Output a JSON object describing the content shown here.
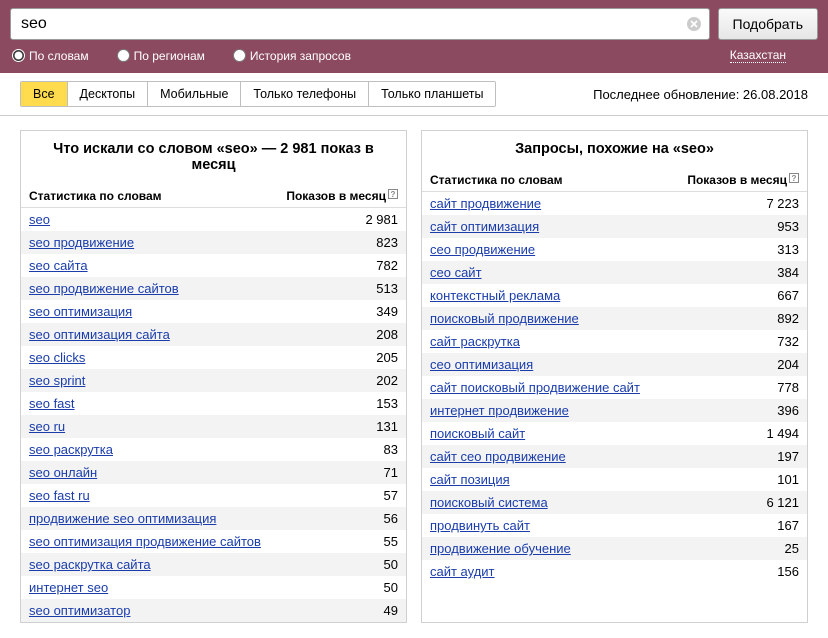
{
  "search": {
    "value": "seo",
    "button": "Подобрать"
  },
  "options": {
    "words": "По словам",
    "regions": "По регионам",
    "history": "История запросов",
    "region_link": "Казахстан"
  },
  "tabs": [
    "Все",
    "Десктопы",
    "Мобильные",
    "Только телефоны",
    "Только планшеты"
  ],
  "active_tab": 0,
  "update_label": "Последнее обновление: 26.08.2018",
  "col_headers": {
    "kw": "Статистика по словам",
    "count": "Показов в месяц"
  },
  "left": {
    "title": "Что искали со словом «seo» — 2 981 показ в месяц",
    "rows": [
      {
        "kw": "seo",
        "count": "2 981"
      },
      {
        "kw": "seo продвижение",
        "count": "823"
      },
      {
        "kw": "seo сайта",
        "count": "782"
      },
      {
        "kw": "seo продвижение сайтов",
        "count": "513"
      },
      {
        "kw": "seo оптимизация",
        "count": "349"
      },
      {
        "kw": "seo оптимизация сайта",
        "count": "208"
      },
      {
        "kw": "seo clicks",
        "count": "205"
      },
      {
        "kw": "seo sprint",
        "count": "202"
      },
      {
        "kw": "seo fast",
        "count": "153"
      },
      {
        "kw": "seo ru",
        "count": "131"
      },
      {
        "kw": "seo раскрутка",
        "count": "83"
      },
      {
        "kw": "seo онлайн",
        "count": "71"
      },
      {
        "kw": "seo fast ru",
        "count": "57"
      },
      {
        "kw": "продвижение seo оптимизация",
        "count": "56"
      },
      {
        "kw": "seo оптимизация продвижение сайтов",
        "count": "55"
      },
      {
        "kw": "seo раскрутка сайта",
        "count": "50"
      },
      {
        "kw": "интернет seo",
        "count": "50"
      },
      {
        "kw": "seo оптимизатор",
        "count": "49"
      }
    ]
  },
  "right": {
    "title": "Запросы, похожие на «seo»",
    "rows": [
      {
        "kw": "сайт продвижение",
        "count": "7 223"
      },
      {
        "kw": "сайт оптимизация",
        "count": "953"
      },
      {
        "kw": "сео продвижение",
        "count": "313"
      },
      {
        "kw": "сео сайт",
        "count": "384"
      },
      {
        "kw": "контекстный реклама",
        "count": "667"
      },
      {
        "kw": "поисковый продвижение",
        "count": "892"
      },
      {
        "kw": "сайт раскрутка",
        "count": "732"
      },
      {
        "kw": "сео оптимизация",
        "count": "204"
      },
      {
        "kw": "сайт поисковый продвижение сайт",
        "count": "778"
      },
      {
        "kw": "интернет продвижение",
        "count": "396"
      },
      {
        "kw": "поисковый сайт",
        "count": "1 494"
      },
      {
        "kw": "сайт сео продвижение",
        "count": "197"
      },
      {
        "kw": "сайт позиция",
        "count": "101"
      },
      {
        "kw": "поисковый система",
        "count": "6 121"
      },
      {
        "kw": "продвинуть сайт",
        "count": "167"
      },
      {
        "kw": "продвижение обучение",
        "count": "25"
      },
      {
        "kw": "сайт аудит",
        "count": "156"
      }
    ]
  }
}
